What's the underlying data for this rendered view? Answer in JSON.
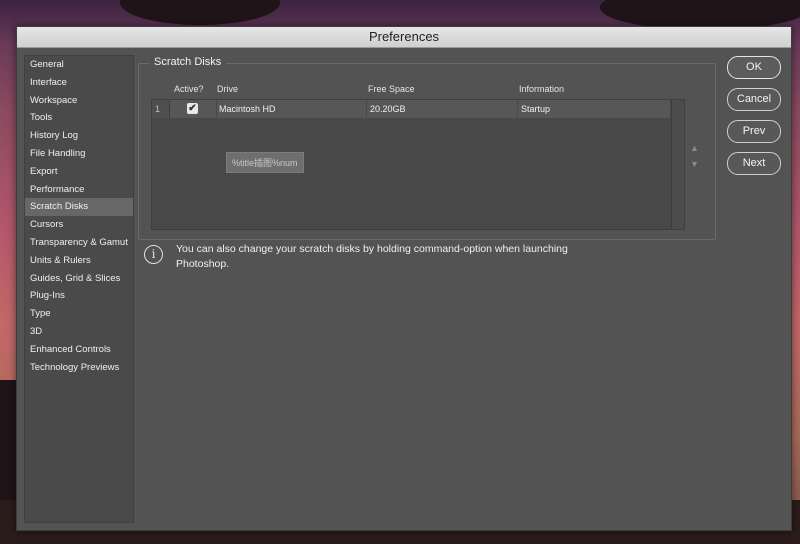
{
  "window": {
    "title": "Preferences"
  },
  "sidebar": {
    "items": [
      "General",
      "Interface",
      "Workspace",
      "Tools",
      "History Log",
      "File Handling",
      "Export",
      "Performance",
      "Scratch Disks",
      "Cursors",
      "Transparency & Gamut",
      "Units & Rulers",
      "Guides, Grid & Slices",
      "Plug-Ins",
      "Type",
      "3D",
      "Enhanced Controls",
      "Technology Previews"
    ],
    "selected": "Scratch Disks"
  },
  "scratch": {
    "title": "Scratch Disks",
    "columns": {
      "active": "Active?",
      "drive": "Drive",
      "free": "Free Space",
      "info": "Information"
    },
    "rows": [
      {
        "index": "1",
        "active": true,
        "drive": "Macintosh HD",
        "free": "20.20GB",
        "info": "Startup"
      }
    ],
    "watermark": "%title插图%num",
    "arrow_up": "▲",
    "arrow_down": "▼"
  },
  "info": {
    "icon": "info-icon",
    "text": "You can also change your scratch disks by holding command-option when launching Photoshop."
  },
  "buttons": {
    "ok": "OK",
    "cancel": "Cancel",
    "prev": "Prev",
    "next": "Next"
  }
}
